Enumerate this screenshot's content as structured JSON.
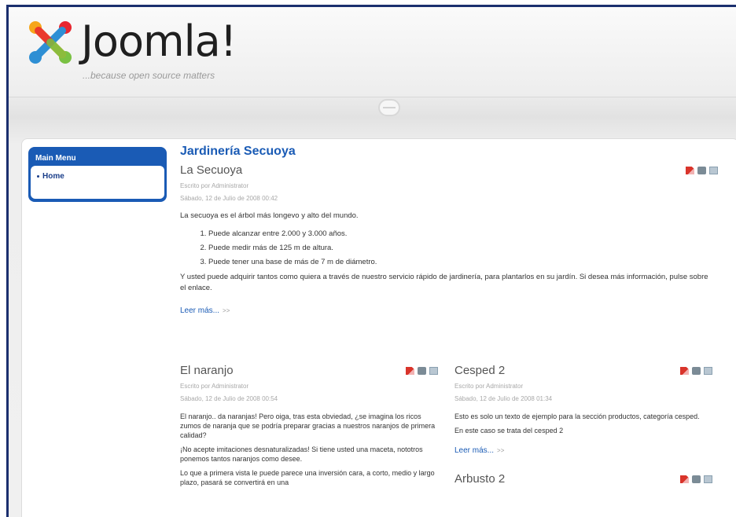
{
  "header": {
    "logo_text": "Joomla!",
    "tagline": "...because open source matters"
  },
  "menu": {
    "title": "Main Menu",
    "items": [
      {
        "label": "Home"
      }
    ]
  },
  "section_title": "Jardinería Secuoya",
  "article_main": {
    "title": "La Secuoya",
    "author": "Escrito por Administrator",
    "date": "Sábado, 12 de Julio de 2008 00:42",
    "intro": "La secuoya es el árbol más longevo y alto del mundo.",
    "list": [
      "Puede alcanzar entre 2.000 y 3.000 años.",
      "Puede medir más de 125 m de altura.",
      "Puede tener una base de más de 7 m de diámetro."
    ],
    "body": "Y usted puede adquirir tantos como quiera a través de nuestro servicio rápido de jardinería, para plantarlos en su jardín. Si desea más información, pulse sobre el enlace.",
    "readmore": "Leer más...",
    "readmore_arrow": ">>"
  },
  "article_left": {
    "title": "El naranjo",
    "author": "Escrito por Administrator",
    "date": "Sábado, 12 de Julio de 2008 00:54",
    "p1": "El naranjo.. da naranjas! Pero oiga, tras esta obviedad, ¿se imagina los ricos zumos de naranja que se podría preparar gracias a nuestros naranjos de primera calidad?",
    "p2": "¡No acepte imitaciones desnaturalizadas! Si tiene usted una maceta, nototros ponemos tantos naranjos como desee.",
    "p3": "Lo que a primera vista le puede parece una inversión cara, a corto, medio y largo plazo, pasará se convertirá en una"
  },
  "article_right": {
    "title": "Cesped 2",
    "author": "Escrito por Administrator",
    "date": "Sábado, 12 de Julio de 2008 01:34",
    "p1": "Esto es solo un texto de ejemplo para la sección productos, categoría cesped.",
    "p2": "En este caso se trata del cesped 2",
    "readmore": "Leer más...",
    "readmore_arrow": ">>"
  },
  "article_right2": {
    "title": "Arbusto 2"
  },
  "icons": [
    "pdf-icon",
    "print-icon",
    "email-icon"
  ],
  "colors": {
    "accent": "#1a5bb5",
    "frame": "#1b2f6e"
  }
}
